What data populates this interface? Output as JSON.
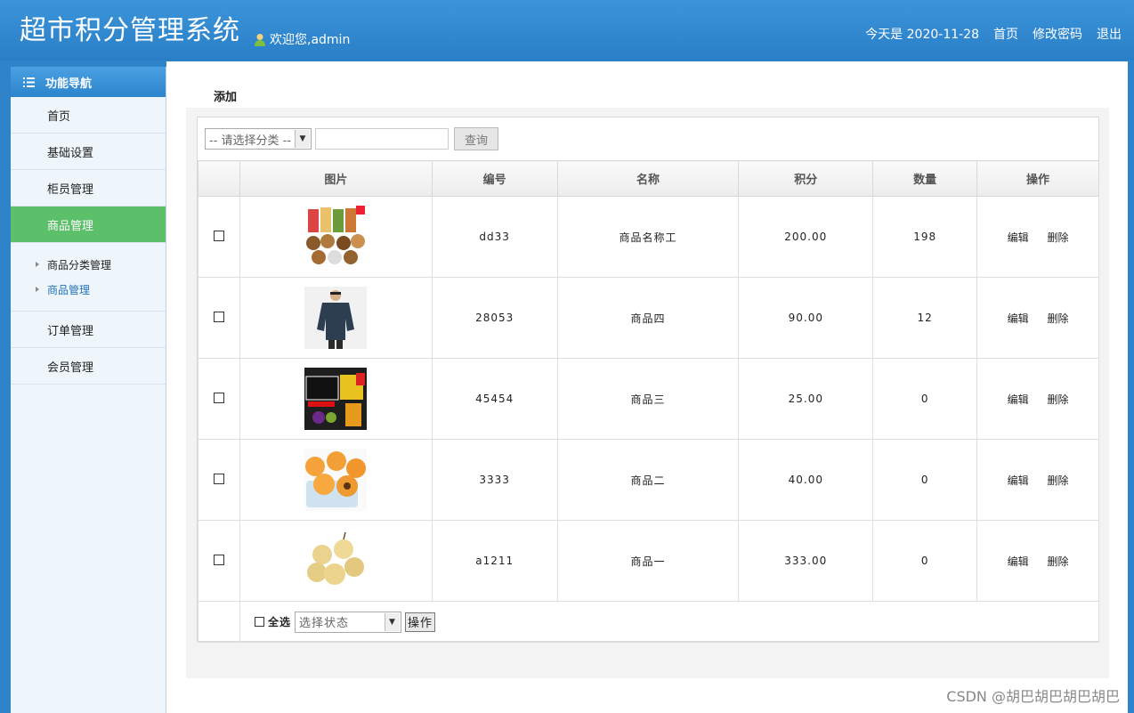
{
  "header": {
    "title": "超市积分管理系统",
    "welcome": "欢迎您,admin",
    "date_text": "今天是 2020-11-28",
    "links": [
      "首页",
      "修改密码",
      "退出"
    ]
  },
  "sidebar": {
    "heading": "功能导航",
    "items": [
      {
        "label": "首页"
      },
      {
        "label": "基础设置"
      },
      {
        "label": "柜员管理"
      },
      {
        "label": "商品管理"
      }
    ],
    "sub_items": [
      {
        "label": "商品分类管理"
      },
      {
        "label": "商品管理"
      }
    ],
    "items_after": [
      {
        "label": "订单管理"
      },
      {
        "label": "会员管理"
      }
    ]
  },
  "main": {
    "add_label": "添加",
    "search": {
      "category_placeholder": "-- 请选择分类 --",
      "query_label": "查询"
    },
    "table": {
      "headers": [
        "图片",
        "编号",
        "名称",
        "积分",
        "数量",
        "操作"
      ],
      "rows": [
        {
          "image": "snack-nuts-image",
          "code": "dd33",
          "name": "商品名称工",
          "points": "200.00",
          "qty": "198"
        },
        {
          "image": "jacket-man-image",
          "code": "28053",
          "name": "商品四",
          "points": "90.00",
          "qty": "12"
        },
        {
          "image": "promo-poster-image",
          "code": "45454",
          "name": "商品三",
          "points": "25.00",
          "qty": "0"
        },
        {
          "image": "apricot-fruit-image",
          "code": "3333",
          "name": "商品二",
          "points": "40.00",
          "qty": "0"
        },
        {
          "image": "pear-fruit-image",
          "code": "a1211",
          "name": "商品一",
          "points": "333.00",
          "qty": "0"
        }
      ],
      "edit_label": "编辑",
      "delete_label": "删除"
    },
    "footer": {
      "select_all_label": "全选",
      "status_placeholder": "选择状态",
      "operate_label": "操作"
    }
  },
  "watermark": "CSDN @胡巴胡巴胡巴胡巴",
  "colors": {
    "header_blue": "#2e83c9",
    "active_green": "#5cbf6a",
    "sidebar_bg": "#eef5fb"
  }
}
